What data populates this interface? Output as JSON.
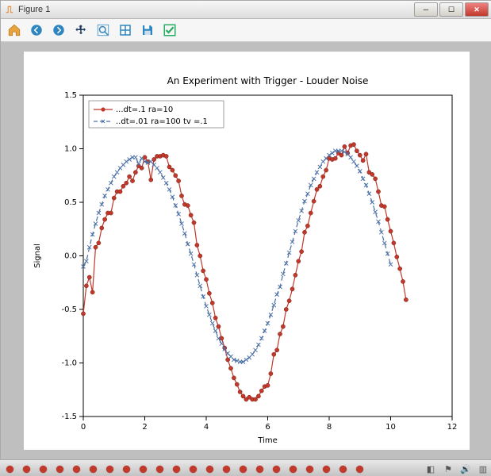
{
  "window": {
    "title": "Figure 1"
  },
  "toolbar": {
    "items": [
      "home",
      "back",
      "forward",
      "pan",
      "zoom",
      "subplots",
      "save",
      "check"
    ]
  },
  "chart_data": {
    "type": "line",
    "title": "An Experiment with Trigger - Louder Noise",
    "xlabel": "Time",
    "ylabel": "Signal",
    "xlim": [
      0,
      12
    ],
    "ylim": [
      -1.5,
      1.5
    ],
    "xticks": [
      0,
      2,
      4,
      6,
      8,
      10,
      12
    ],
    "yticks": [
      -1.5,
      -1.0,
      -0.5,
      0.0,
      0.5,
      1.0,
      1.5
    ],
    "legend": {
      "loc": "upper left"
    },
    "series": [
      {
        "name": "...dt=.1 ra=10",
        "color": "#c0392b",
        "marker": "o",
        "ls": "-",
        "x": [
          0.0,
          0.1,
          0.2,
          0.3,
          0.4,
          0.5,
          0.6,
          0.7,
          0.8,
          0.9,
          1.0,
          1.1,
          1.2,
          1.3,
          1.4,
          1.5,
          1.6,
          1.7,
          1.8,
          1.9,
          2.0,
          2.1,
          2.2,
          2.3,
          2.4,
          2.5,
          2.6,
          2.7,
          2.8,
          2.9,
          3.0,
          3.1,
          3.2,
          3.3,
          3.4,
          3.5,
          3.6,
          3.7,
          3.8,
          3.9,
          4.0,
          4.1,
          4.2,
          4.3,
          4.4,
          4.5,
          4.6,
          4.7,
          4.8,
          4.9,
          5.0,
          5.1,
          5.2,
          5.3,
          5.4,
          5.5,
          5.6,
          5.7,
          5.8,
          5.9,
          6.0,
          6.1,
          6.2,
          6.3,
          6.4,
          6.5,
          6.6,
          6.7,
          6.8,
          6.9,
          7.0,
          7.1,
          7.2,
          7.3,
          7.4,
          7.5,
          7.6,
          7.7,
          7.8,
          7.9,
          8.0,
          8.1,
          8.2,
          8.3,
          8.4,
          8.5,
          8.6,
          8.7,
          8.8,
          8.9,
          9.0,
          9.1,
          9.2,
          9.3,
          9.4,
          9.5,
          9.6,
          9.7,
          9.8,
          9.9,
          10.0,
          10.1,
          10.2,
          10.3,
          10.4,
          10.5
        ],
        "y": [
          -0.54,
          -0.28,
          -0.2,
          -0.34,
          0.08,
          0.12,
          0.26,
          0.34,
          0.4,
          0.4,
          0.54,
          0.6,
          0.6,
          0.65,
          0.68,
          0.74,
          0.7,
          0.78,
          0.84,
          0.82,
          0.92,
          0.88,
          0.71,
          0.9,
          0.93,
          0.93,
          0.94,
          0.93,
          0.83,
          0.8,
          0.75,
          0.7,
          0.56,
          0.48,
          0.47,
          0.38,
          0.31,
          0.1,
          0.0,
          -0.14,
          -0.22,
          -0.35,
          -0.44,
          -0.58,
          -0.66,
          -0.77,
          -0.86,
          -0.97,
          -1.05,
          -1.14,
          -1.2,
          -1.27,
          -1.31,
          -1.34,
          -1.32,
          -1.34,
          -1.34,
          -1.31,
          -1.26,
          -1.22,
          -1.21,
          -1.1,
          -0.92,
          -0.88,
          -0.73,
          -0.66,
          -0.5,
          -0.42,
          -0.31,
          -0.18,
          -0.05,
          0.04,
          0.22,
          0.28,
          0.4,
          0.51,
          0.62,
          0.65,
          0.74,
          0.8,
          0.91,
          0.9,
          0.91,
          0.96,
          0.94,
          1.02,
          0.96,
          1.03,
          1.04,
          0.98,
          0.94,
          0.89,
          0.95,
          0.78,
          0.76,
          0.72,
          0.6,
          0.47,
          0.46,
          0.34,
          0.23,
          0.12,
          -0.01,
          -0.12,
          -0.24,
          -0.41
        ]
      },
      {
        "name": "..dt=.01 ra=100 tv =.1",
        "color": "#4a6fa5",
        "marker": "x",
        "ls": "--",
        "x": [
          0.0,
          0.1,
          0.2,
          0.3,
          0.4,
          0.5,
          0.6,
          0.7,
          0.8,
          0.9,
          1.0,
          1.1,
          1.2,
          1.3,
          1.4,
          1.5,
          1.6,
          1.7,
          1.8,
          1.9,
          2.0,
          2.1,
          2.2,
          2.3,
          2.4,
          2.5,
          2.6,
          2.7,
          2.8,
          2.9,
          3.0,
          3.1,
          3.2,
          3.3,
          3.4,
          3.5,
          3.6,
          3.7,
          3.8,
          3.9,
          4.0,
          4.1,
          4.2,
          4.3,
          4.4,
          4.5,
          4.6,
          4.7,
          4.8,
          4.9,
          5.0,
          5.1,
          5.2,
          5.3,
          5.4,
          5.5,
          5.6,
          5.7,
          5.8,
          5.9,
          6.0,
          6.1,
          6.2,
          6.3,
          6.4,
          6.5,
          6.6,
          6.7,
          6.8,
          6.9,
          7.0,
          7.1,
          7.2,
          7.3,
          7.4,
          7.5,
          7.6,
          7.7,
          7.8,
          7.9,
          8.0,
          8.1,
          8.2,
          8.3,
          8.4,
          8.5,
          8.6,
          8.7,
          8.8,
          8.9,
          9.0,
          9.1,
          9.2,
          9.3,
          9.4,
          9.5,
          9.6,
          9.7,
          9.8,
          9.9,
          10.0
        ],
        "y": [
          -0.1,
          -0.05,
          0.08,
          0.2,
          0.3,
          0.4,
          0.48,
          0.56,
          0.62,
          0.68,
          0.74,
          0.78,
          0.82,
          0.85,
          0.88,
          0.9,
          0.92,
          0.92,
          0.86,
          0.91,
          0.88,
          0.87,
          0.88,
          0.85,
          0.82,
          0.78,
          0.73,
          0.68,
          0.62,
          0.55,
          0.47,
          0.39,
          0.3,
          0.21,
          0.11,
          0.02,
          -0.08,
          -0.18,
          -0.28,
          -0.38,
          -0.47,
          -0.55,
          -0.63,
          -0.7,
          -0.77,
          -0.82,
          -0.87,
          -0.91,
          -0.94,
          -0.97,
          -0.98,
          -0.99,
          -0.99,
          -0.97,
          -0.95,
          -0.92,
          -0.88,
          -0.83,
          -0.77,
          -0.7,
          -0.63,
          -0.55,
          -0.46,
          -0.36,
          -0.29,
          -0.17,
          -0.07,
          0.03,
          0.13,
          0.23,
          0.33,
          0.42,
          0.51,
          0.58,
          0.66,
          0.72,
          0.78,
          0.83,
          0.88,
          0.91,
          0.94,
          0.96,
          0.98,
          0.98,
          0.98,
          0.97,
          0.95,
          0.92,
          0.88,
          0.84,
          0.79,
          0.72,
          0.66,
          0.58,
          0.5,
          0.41,
          0.32,
          0.22,
          0.12,
          0.02,
          -0.08
        ]
      }
    ]
  }
}
